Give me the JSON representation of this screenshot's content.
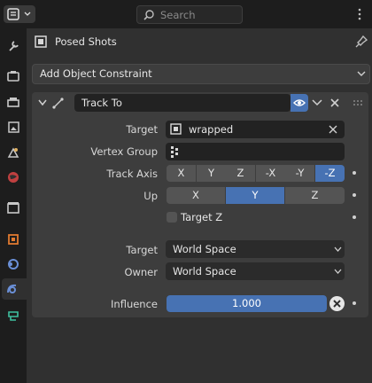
{
  "header": {
    "search_placeholder": "Search"
  },
  "tabs": [
    "tool-tab",
    "render-tab",
    "output-tab",
    "view-layer-tab",
    "scene-tab",
    "world-tab",
    "collection-tab",
    "object-tab",
    "modifiers-tab",
    "particles-tab",
    "physics-tab",
    "constraints-tab",
    "data-tab"
  ],
  "context": {
    "object_name": "Posed Shots"
  },
  "add_constraint_label": "Add Object Constraint",
  "constraint": {
    "name": "Track To",
    "target_label": "Target",
    "target_value": "wrapped",
    "vertex_group_label": "Vertex Group",
    "vertex_group_value": "",
    "track_axis_label": "Track Axis",
    "track_axis_options": [
      "X",
      "Y",
      "Z",
      "-X",
      "-Y",
      "-Z"
    ],
    "track_axis_selected": "-Z",
    "up_label": "Up",
    "up_options": [
      "X",
      "Y",
      "Z"
    ],
    "up_selected": "Y",
    "target_z_label": "Target Z",
    "target_z_checked": false,
    "target_space_label": "Target",
    "target_space_value": "World Space",
    "owner_space_label": "Owner",
    "owner_space_value": "World Space",
    "influence_label": "Influence",
    "influence_value": "1.000",
    "influence_fraction": 1.0
  },
  "colors": {
    "accent": "#4772b3",
    "panel": "#3d3d3d",
    "background": "#303030",
    "field": "#222222",
    "button": "#545454"
  }
}
